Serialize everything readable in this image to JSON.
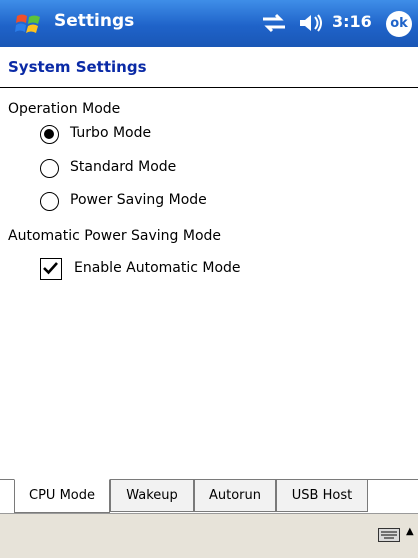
{
  "titlebar": {
    "title": "Settings",
    "time": "3:16",
    "ok_label": "ok"
  },
  "page": {
    "title": "System Settings"
  },
  "operation_mode": {
    "label": "Operation Mode",
    "options": [
      {
        "label": "Turbo Mode",
        "selected": true
      },
      {
        "label": "Standard Mode",
        "selected": false
      },
      {
        "label": "Power Saving Mode",
        "selected": false
      }
    ]
  },
  "auto_power": {
    "label": "Automatic Power Saving Mode",
    "checkbox_label": "Enable Automatic Mode",
    "checked": true
  },
  "tabs": [
    {
      "label": "CPU Mode",
      "active": true
    },
    {
      "label": "Wakeup",
      "active": false
    },
    {
      "label": "Autorun",
      "active": false
    },
    {
      "label": "USB Host",
      "active": false
    }
  ],
  "icons": {
    "start": "windows-flag-icon",
    "connectivity": "connectivity-icon",
    "volume": "speaker-icon",
    "keyboard": "keyboard-icon"
  }
}
